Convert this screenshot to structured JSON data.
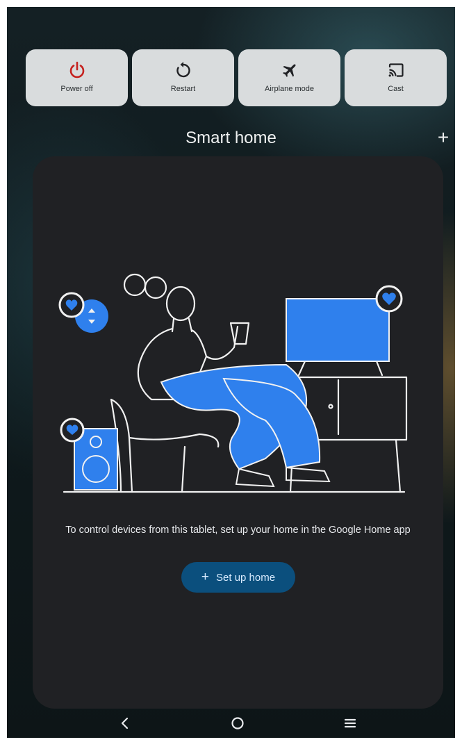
{
  "quick_actions": [
    {
      "label": "Power off",
      "icon": "power-icon",
      "color": "#c5221f"
    },
    {
      "label": "Restart",
      "icon": "restart-icon"
    },
    {
      "label": "Airplane mode",
      "icon": "airplane-icon"
    },
    {
      "label": "Cast",
      "icon": "cast-icon"
    }
  ],
  "smart_home": {
    "title": "Smart home",
    "add_label": "+",
    "description": "To control devices from this tablet, set up your home in the Google Home app",
    "setup_plus": "+",
    "setup_label": "Set up home",
    "accent": "#2f80ed"
  },
  "nav": {
    "back": "back-icon",
    "home": "home-icon",
    "menu": "menu-icon"
  }
}
